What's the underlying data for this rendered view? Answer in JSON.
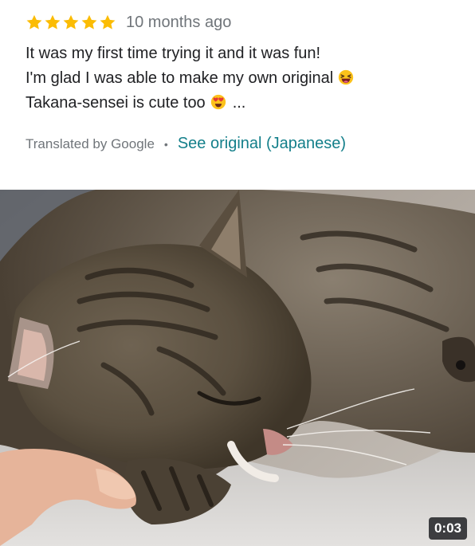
{
  "review": {
    "rating": 5,
    "star_color": "#fbbc04",
    "time": "10 months ago",
    "lines": [
      "It was my first time trying it and it was fun!",
      "I'm glad I was able to make my own original",
      "Takana-sensei is cute too"
    ],
    "emoji_line2": "laughing-face-emoji",
    "emoji_line3": "heart-eyes-emoji",
    "ellipsis": "...",
    "translated_by": "Translated by Google",
    "separator": "•",
    "see_original": "See original (Japanese)",
    "link_color": "#137f8a"
  },
  "media": {
    "type": "video",
    "subject": "sleeping tabby cat",
    "duration": "0:03"
  }
}
